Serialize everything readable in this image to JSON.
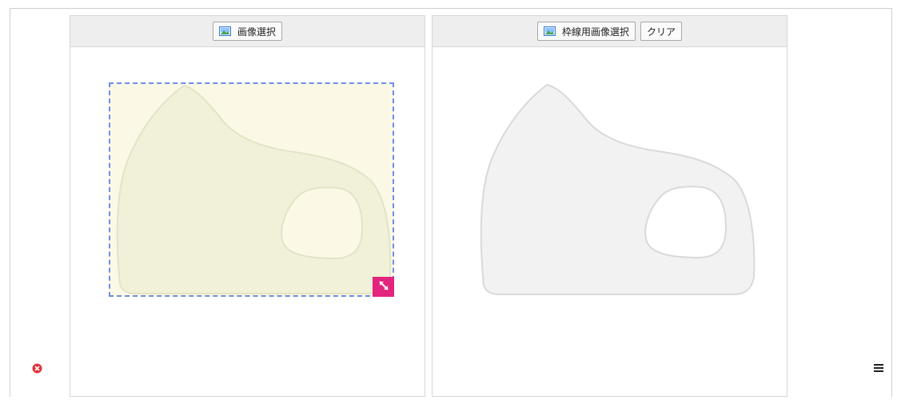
{
  "left_panel": {
    "select_image_label": "画像選択",
    "image_icon": "image-icon",
    "resize_icon": "resize-diagonal-icon"
  },
  "right_panel": {
    "select_frame_image_label": "枠線用画像選択",
    "clear_label": "クリア",
    "image_icon": "image-icon"
  },
  "controls": {
    "delete_icon": "delete-circle-icon",
    "menu_icon": "hamburger-menu-icon"
  },
  "colors": {
    "crop_fill": "#fbf9e6",
    "crop_border": "#6f8de6",
    "resize_handle": "#e3257e",
    "delete": "#e0343b",
    "header_bg": "#eeeeee"
  }
}
